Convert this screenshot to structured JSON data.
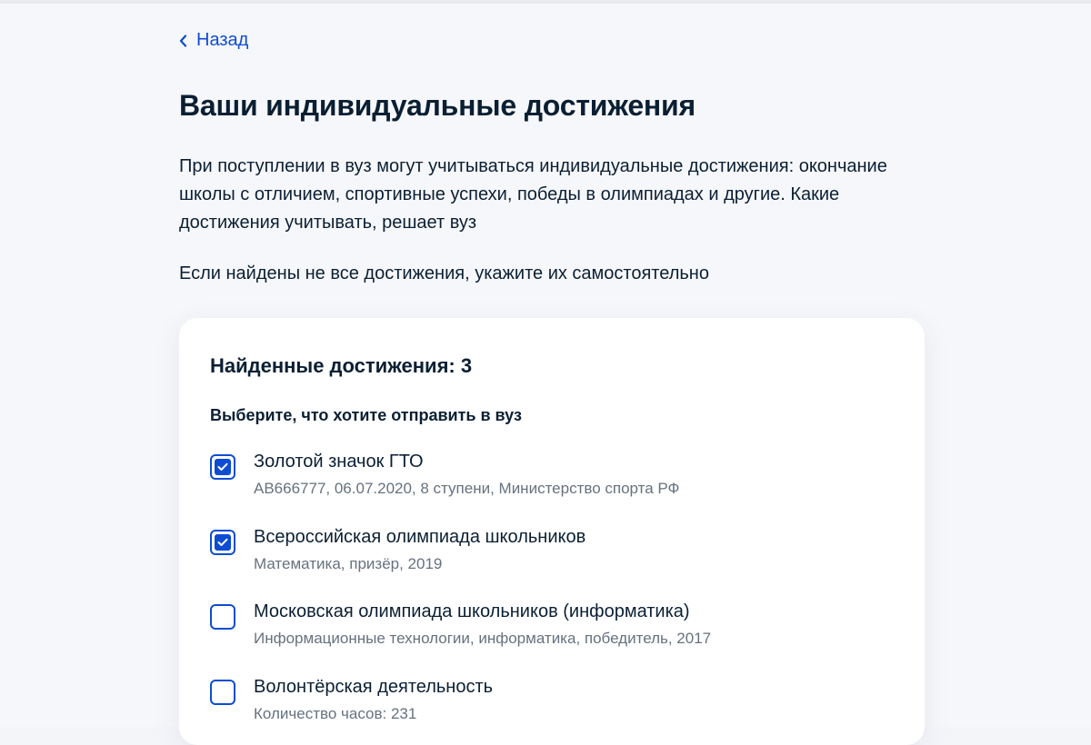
{
  "nav": {
    "back_label": "Назад"
  },
  "page": {
    "title": "Ваши индивидуальные достижения",
    "intro": "При поступлении в вуз могут учитываться индивидуальные достижения: окончание школы с отличием, спортивные успехи, победы в олимпиадах и другие. Какие достижения учитывать, решает вуз",
    "hint": "Если найдены не все достижения, укажите их самостоятельно"
  },
  "card": {
    "title": "Найденные достижения: 3",
    "subtitle": "Выберите, что хотите отправить в вуз",
    "items": [
      {
        "title": "Золотой значок ГТО",
        "description": "АВ666777, 06.07.2020, 8 ступени, Министерство спорта РФ",
        "checked": true
      },
      {
        "title": "Всероссийская олимпиада школьников",
        "description": "Математика, призёр, 2019",
        "checked": true
      },
      {
        "title": "Московская олимпиада школьников (информатика)",
        "description": "Информационные технологии, информатика, победитель, 2017",
        "checked": false
      },
      {
        "title": "Волонтёрская деятельность",
        "description": "Количество часов: 231",
        "checked": false
      }
    ]
  },
  "colors": {
    "accent": "#0d4cd3",
    "text": "#0b1f33",
    "muted": "#66727f",
    "background": "#f6f7fa",
    "card": "#ffffff"
  },
  "icons": {
    "back": "chevron-left-icon",
    "check": "checkmark-icon"
  }
}
